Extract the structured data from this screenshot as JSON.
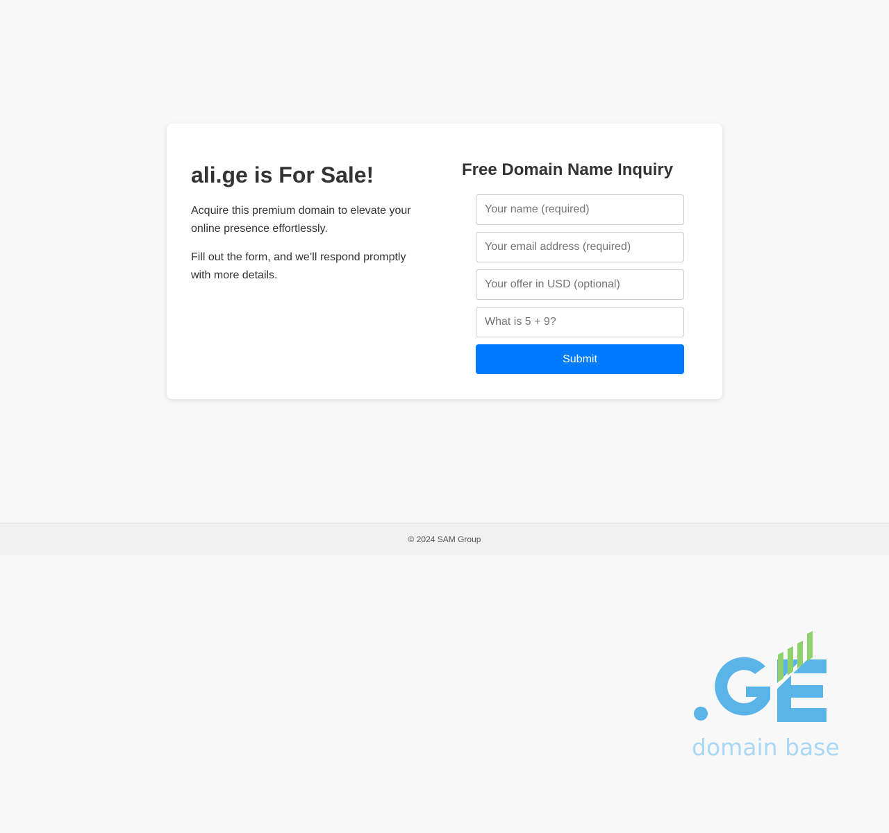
{
  "main": {
    "title": "ali.ge is For Sale!",
    "paragraphs": [
      "Acquire this premium domain to elevate your online presence effortlessly.",
      "Fill out the form, and we’ll respond promptly with more details."
    ]
  },
  "form": {
    "title": "Free Domain Name Inquiry",
    "name_placeholder": "Your name (required)",
    "email_placeholder": "Your email address (required)",
    "offer_placeholder": "Your offer in USD (optional)",
    "captcha_placeholder": "What is 5 + 9?",
    "submit_label": "Submit"
  },
  "footer": {
    "copyright": "© 2024 SAM Group"
  },
  "logo": {
    "mark": ".GE",
    "tagline": "domain base"
  },
  "colors": {
    "accent": "#007bff",
    "logo_blue": "#5ab4e8",
    "logo_green": "#8fd16f",
    "background": "#f8f8f8"
  }
}
